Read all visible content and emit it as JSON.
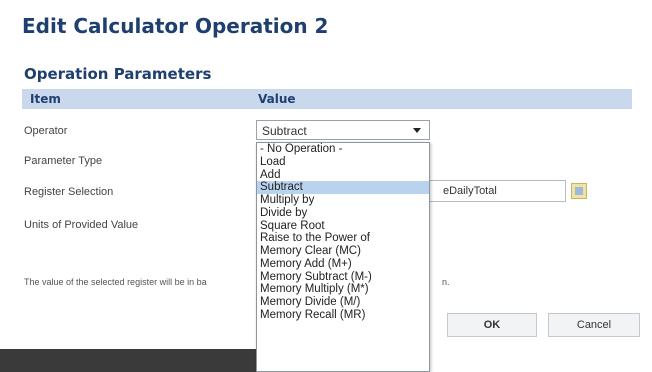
{
  "dialog": {
    "title": "Edit Calculator Operation 2",
    "section_title": "Operation Parameters",
    "table_header": {
      "item": "Item",
      "value": "Value"
    },
    "rows": {
      "operator": "Operator",
      "parameter_type": "Parameter Type",
      "register_selection": "Register Selection",
      "units": "Units of Provided Value"
    },
    "operator_select": {
      "value": "Subtract"
    },
    "register_input": {
      "value": "eDailyTotal"
    },
    "help_text": {
      "start": "The value of the selected register will be in ba",
      "end": "n."
    },
    "buttons": {
      "ok": "OK",
      "cancel": "Cancel"
    }
  },
  "dropdown": {
    "options": [
      "- No Operation -",
      "Load",
      "Add",
      "Subtract",
      "Multiply by",
      "Divide by",
      "Square Root",
      "Raise to the Power of",
      "Memory Clear (MC)",
      "Memory Add (M+)",
      "Memory Subtract (M-)",
      "Memory Multiply (M*)",
      "Memory Divide (M/)",
      "Memory Recall (MR)"
    ],
    "selected_index": 3
  }
}
